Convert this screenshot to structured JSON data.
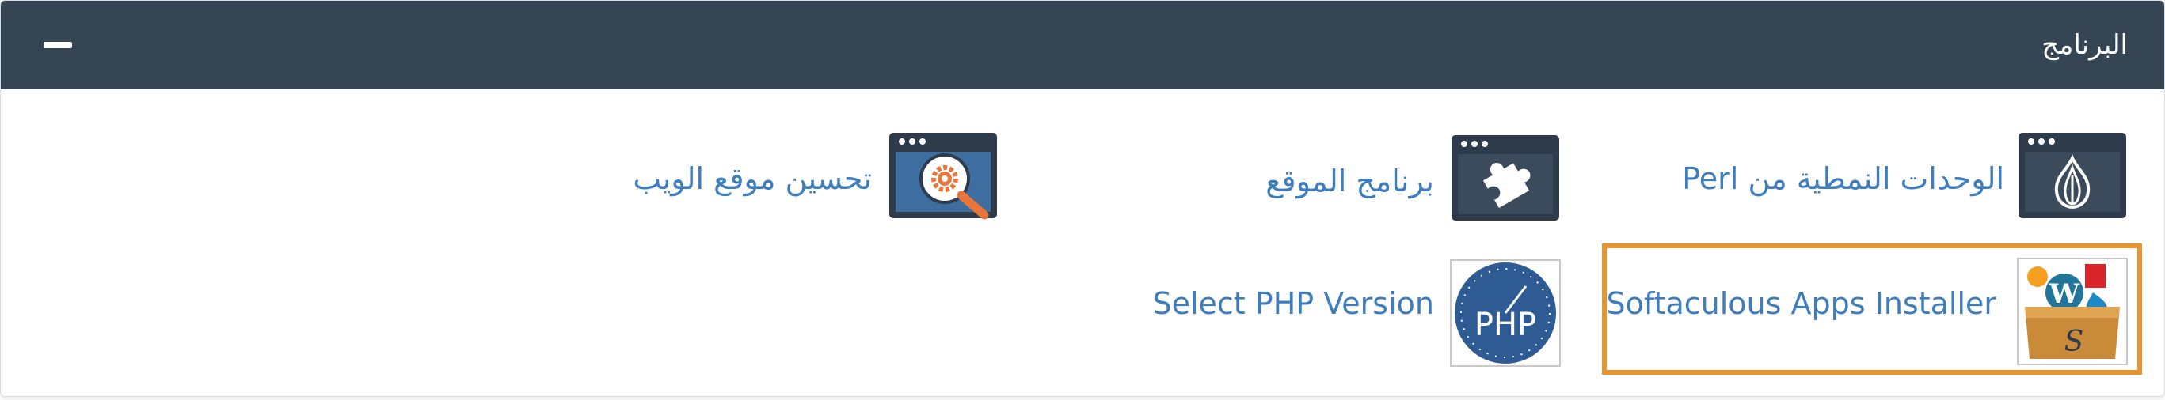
{
  "panel": {
    "title": "البرنامج",
    "collapse_icon": "minus-icon"
  },
  "items": [
    {
      "label": "الوحدات النمطية من Perl",
      "icon": "perl-onion-icon"
    },
    {
      "label": "برنامج الموقع",
      "icon": "puzzle-piece-icon"
    },
    {
      "label": "تحسين موقع الويب",
      "icon": "gear-magnifier-icon"
    },
    {
      "label": "Softaculous Apps Installer",
      "icon": "softaculous-icon"
    },
    {
      "label": "Select PHP Version",
      "icon": "php-icon"
    }
  ],
  "colors": {
    "header_bg": "#364554",
    "link": "#3f7dbd",
    "highlight": "#e8942f",
    "icon_dark": "#2d3b4a",
    "icon_blue": "#3e6ea0",
    "icon_orange": "#e8753a"
  }
}
